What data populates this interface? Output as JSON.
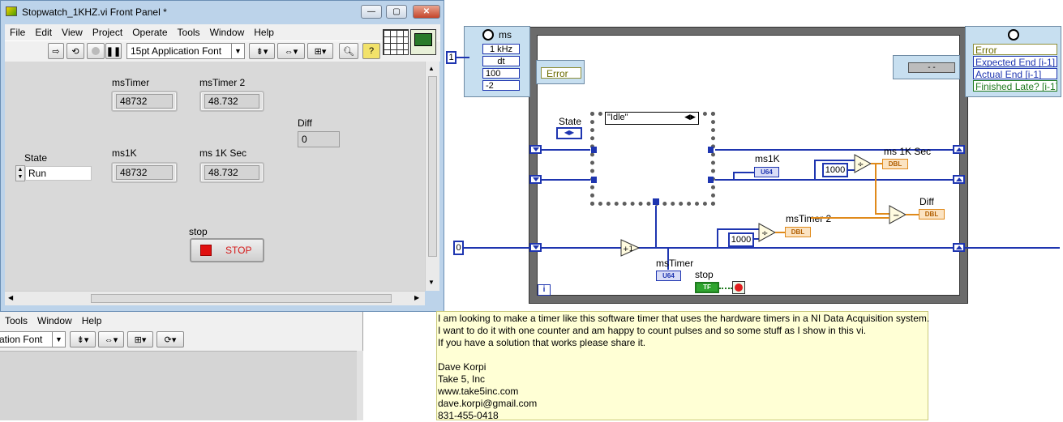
{
  "front_panel": {
    "title": "Stopwatch_1KHZ.vi Front Panel *",
    "menu": [
      "File",
      "Edit",
      "View",
      "Project",
      "Operate",
      "Tools",
      "Window",
      "Help"
    ],
    "toolbar": {
      "font": "15pt Application Font"
    },
    "controls": {
      "msTimer": {
        "label": "msTimer",
        "value": "48732"
      },
      "msTimer2": {
        "label": "msTimer 2",
        "value": "48.732"
      },
      "diff": {
        "label": "Diff",
        "value": "0"
      },
      "state": {
        "label": "State",
        "value": "Run"
      },
      "ms1k": {
        "label": "ms1K",
        "value": "48732"
      },
      "ms1ksec": {
        "label": "ms 1K Sec",
        "value": "48.732"
      },
      "stop": {
        "label": "stop",
        "button": "STOP"
      }
    }
  },
  "back_window": {
    "menu": [
      "Tools",
      "Window",
      "Help"
    ],
    "font": "ation Font"
  },
  "block_diagram": {
    "config_node": {
      "title": "ms",
      "rows": [
        "1 kHz",
        "dt",
        "100",
        "-2"
      ]
    },
    "input_one": "1",
    "input_zero": "0",
    "error_label": "Error",
    "error_out": [
      "Error",
      "Expected End [i-1]",
      "Actual End [i-1]",
      "Finished Late? [i-1]"
    ],
    "state_label": "State",
    "case_label": "\"Idle\"",
    "ms1k_label": "ms1K",
    "ms1ksec_label": "ms 1K Sec",
    "diff_label": "Diff",
    "mstimer2_label": "msTimer 2",
    "mstimer_label": "msTimer",
    "stop_label": "stop",
    "const_1000_a": "1000",
    "const_1000_b": "1000",
    "u64": "U64",
    "dbl": "DBL",
    "tf": "TF",
    "iteration": "i",
    "case_dropdown": "- -"
  },
  "note": {
    "lines": [
      "I am looking to make a timer like this software timer that uses the hardware timers in a NI Data Acquisition system.",
      "I want to do it with one counter and am happy to count pulses and so some stuff as I show in this vi.",
      "If you have a solution that works please share it.",
      "",
      "Dave Korpi",
      "Take 5, Inc",
      "www.take5inc.com",
      "dave.korpi@gmail.com",
      "831-455-0418"
    ]
  },
  "colors": {
    "wire_int": "#1e35b0",
    "wire_dbl": "#e08a1b",
    "note_bg": "#ffffd5"
  }
}
